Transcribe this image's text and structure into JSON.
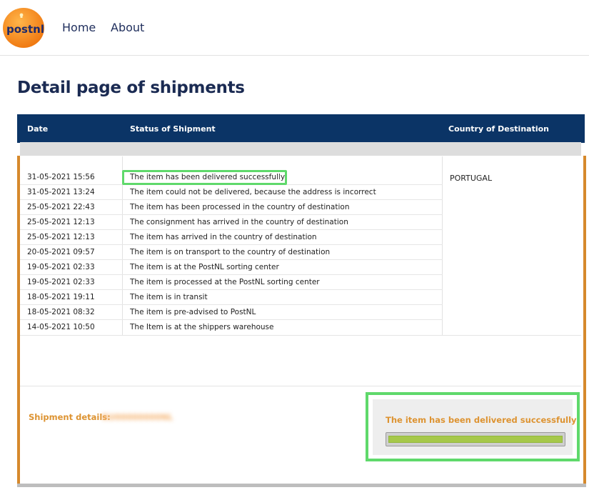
{
  "header": {
    "logo_text": "postnl",
    "nav": [
      {
        "label": "Home"
      },
      {
        "label": "About"
      }
    ]
  },
  "page": {
    "title": "Detail page of shipments"
  },
  "table": {
    "columns": [
      "Date",
      "Status of Shipment",
      "Country of Destination"
    ],
    "country": "PORTUGAL",
    "rows": [
      {
        "date": "31-05-2021 15:56",
        "status": "The item has been delivered successfully"
      },
      {
        "date": "31-05-2021 13:24",
        "status": "The item could not be delivered, because the address is incorrect"
      },
      {
        "date": "25-05-2021 22:43",
        "status": "The item has been processed in the country of destination"
      },
      {
        "date": "25-05-2021 12:13",
        "status": "The consignment has arrived in the country of destination"
      },
      {
        "date": "25-05-2021 12:13",
        "status": "The item has arrived in the country of destination"
      },
      {
        "date": "20-05-2021 09:57",
        "status": "The item is on transport to the country of destination"
      },
      {
        "date": "19-05-2021 02:33",
        "status": "The item is at the PostNL sorting center"
      },
      {
        "date": "19-05-2021 02:33",
        "status": "The item is processed at the PostNL sorting center"
      },
      {
        "date": "18-05-2021 19:11",
        "status": "The item is in transit"
      },
      {
        "date": "18-05-2021 08:32",
        "status": "The item is pre-advised to PostNL"
      },
      {
        "date": "14-05-2021 10:50",
        "status": "The Item is at the shippers warehouse"
      }
    ]
  },
  "details": {
    "label": "Shipment details:",
    "shipment_id": "RU00000000NL",
    "status_text": "The item has been delivered successfully",
    "progress_fraction": 1.0
  },
  "colors": {
    "brand_orange": "#d6892c",
    "header_navy": "#0b3466",
    "highlight_green": "#5fd96b",
    "progress_green": "#a6c84a"
  },
  "icons": {
    "logo": "postnl-logo"
  }
}
